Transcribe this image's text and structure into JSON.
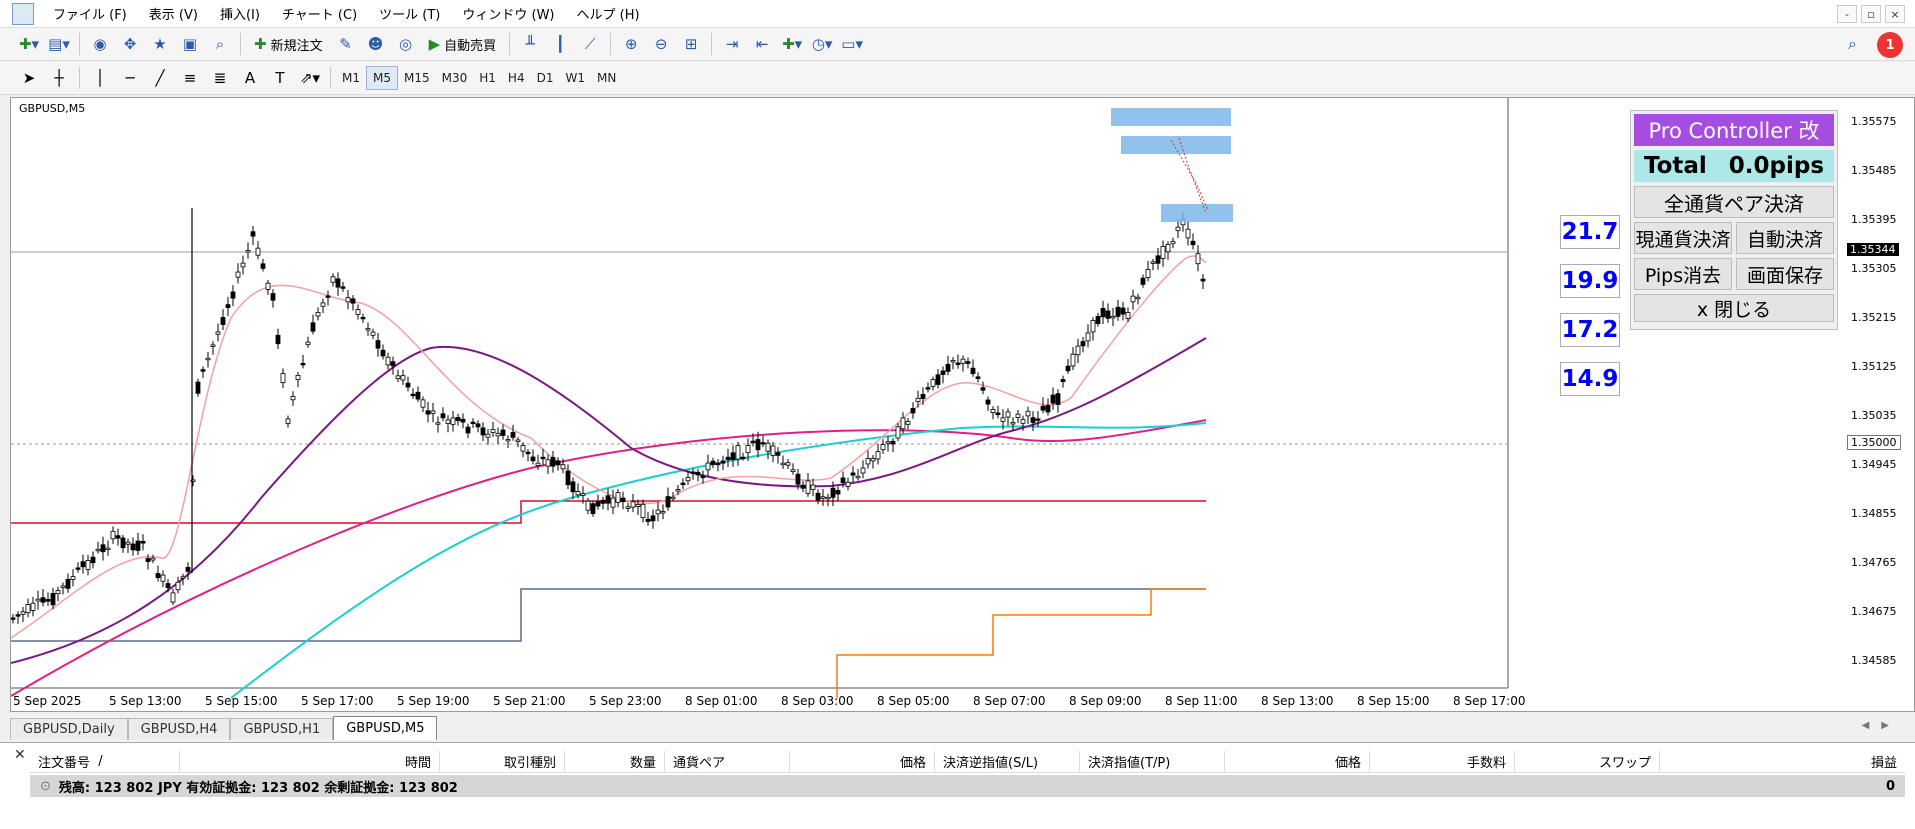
{
  "menubar": {
    "items": [
      "ファイル (F)",
      "表示 (V)",
      "挿入(I)",
      "チャート (C)",
      "ツール (T)",
      "ウィンドウ (W)",
      "ヘルプ (H)"
    ]
  },
  "window_controls": [
    "-",
    "▫",
    "×"
  ],
  "toolbar": {
    "new_order": "新規注文",
    "auto_trade": "自動売買"
  },
  "timeframes": [
    "M1",
    "M5",
    "M15",
    "M30",
    "H1",
    "H4",
    "D1",
    "W1",
    "MN"
  ],
  "active_timeframe": "M5",
  "notification_count": "1",
  "chart": {
    "title": "GBPUSD,M5",
    "price_axis": [
      "1.35575",
      "1.35485",
      "1.35395",
      "1.35305",
      "1.35215",
      "1.35125",
      "1.35035",
      "1.34945",
      "1.34855",
      "1.34765",
      "1.34675",
      "1.34585"
    ],
    "current_price": "1.35344",
    "hline_price": "1.35000",
    "time_axis": [
      "5 Sep 2025",
      "5 Sep 13:00",
      "5 Sep 15:00",
      "5 Sep 17:00",
      "5 Sep 19:00",
      "5 Sep 21:00",
      "5 Sep 23:00",
      "8 Sep 01:00",
      "8 Sep 03:00",
      "8 Sep 05:00",
      "8 Sep 07:00",
      "8 Sep 09:00",
      "8 Sep 11:00",
      "8 Sep 13:00",
      "8 Sep 15:00",
      "8 Sep 17:00"
    ],
    "pips_boxes": [
      "21.7",
      "19.9",
      "17.2",
      "14.9"
    ],
    "colors": {
      "ma_fast": "#f4a0a0",
      "ma_mid": "#7a1a80",
      "ma_cyan": "#1ccfcf",
      "ma_pink": "#e0208a",
      "level_red": "#d0102a",
      "level_blue": "#5a6a8a",
      "level_orange": "#f07a10",
      "candle": "#000000"
    }
  },
  "pro_controller": {
    "title": "Pro Controller 改",
    "total_label": "Total",
    "total_value": "0.0pips",
    "close_all": "全通貨ペア決済",
    "close_current": "現通貨決済",
    "auto_close": "自動決済",
    "clear_pips": "Pips消去",
    "save_screen": "画面保存",
    "close": "x 閉じる"
  },
  "chart_tabs": [
    "GBPUSD,Daily",
    "GBPUSD,H4",
    "GBPUSD,H1",
    "GBPUSD,M5"
  ],
  "active_tab": "GBPUSD,M5",
  "terminal": {
    "columns": [
      "注文番号",
      "/",
      "時間",
      "取引種別",
      "数量",
      "通貨ペア",
      "価格",
      "決済逆指値(S/L)",
      "決済指値(T/P)",
      "価格",
      "手数料",
      "スワップ",
      "損益"
    ],
    "balance_text": "残高: 123 802 JPY  有効証拠金: 123 802  余剰証拠金: 123 802",
    "balance_value": "0"
  }
}
